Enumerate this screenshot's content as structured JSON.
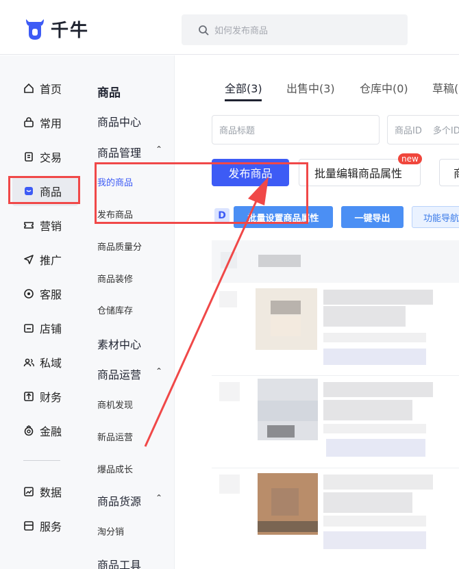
{
  "app": {
    "name": "千牛"
  },
  "search": {
    "placeholder": "如何发布商品"
  },
  "sidebar": {
    "items": [
      {
        "label": "首页",
        "icon": "home-icon"
      },
      {
        "label": "常用",
        "icon": "bag-icon"
      },
      {
        "label": "交易",
        "icon": "document-icon"
      },
      {
        "label": "商品",
        "icon": "product-icon",
        "active": true
      },
      {
        "label": "营销",
        "icon": "ticket-icon"
      },
      {
        "label": "推广",
        "icon": "send-icon"
      },
      {
        "label": "客服",
        "icon": "headset-icon"
      },
      {
        "label": "店铺",
        "icon": "store-icon"
      },
      {
        "label": "私域",
        "icon": "users-icon"
      },
      {
        "label": "财务",
        "icon": "finance-icon"
      },
      {
        "label": "金融",
        "icon": "coin-icon"
      },
      {
        "label": "数据",
        "icon": "chart-icon"
      },
      {
        "label": "服务",
        "icon": "service-icon"
      }
    ]
  },
  "subnav": {
    "title": "商品",
    "items": [
      {
        "label": "商品中心",
        "kind": "h"
      },
      {
        "label": "商品管理",
        "kind": "h"
      },
      {
        "label": "我的商品",
        "kind": "sel"
      },
      {
        "label": "发布商品",
        "kind": "small"
      },
      {
        "label": "商品质量分",
        "kind": "small"
      },
      {
        "label": "商品装修",
        "kind": "small"
      },
      {
        "label": "仓储库存",
        "kind": "small"
      },
      {
        "label": "素材中心",
        "kind": "h"
      },
      {
        "label": "商品运营",
        "kind": "h"
      },
      {
        "label": "商机发现",
        "kind": "small"
      },
      {
        "label": "新品运营",
        "kind": "small"
      },
      {
        "label": "爆品成长",
        "kind": "small"
      },
      {
        "label": "商品货源",
        "kind": "h"
      },
      {
        "label": "淘分销",
        "kind": "small"
      },
      {
        "label": "商品工具",
        "kind": "h"
      }
    ]
  },
  "tabs": [
    {
      "label": "全部(3)"
    },
    {
      "label": "出售中(3)"
    },
    {
      "label": "仓库中(0)"
    },
    {
      "label": "草稿("
    }
  ],
  "filters": {
    "title_placeholder": "商品标题",
    "id_label": "商品ID",
    "id_placeholder": "多个ID,"
  },
  "actions": {
    "publish": "发布商品",
    "batch_edit": "批量编辑商品属性",
    "new_badge": "new",
    "more": "商"
  },
  "toolbar": {
    "batch_set": "批量设置商品属性",
    "export": "一键导出",
    "guide": "功能导航"
  },
  "colors": {
    "primary": "#3d5bf5",
    "highlight_red": "#f04848",
    "tool_blue": "#4b8ff4"
  }
}
